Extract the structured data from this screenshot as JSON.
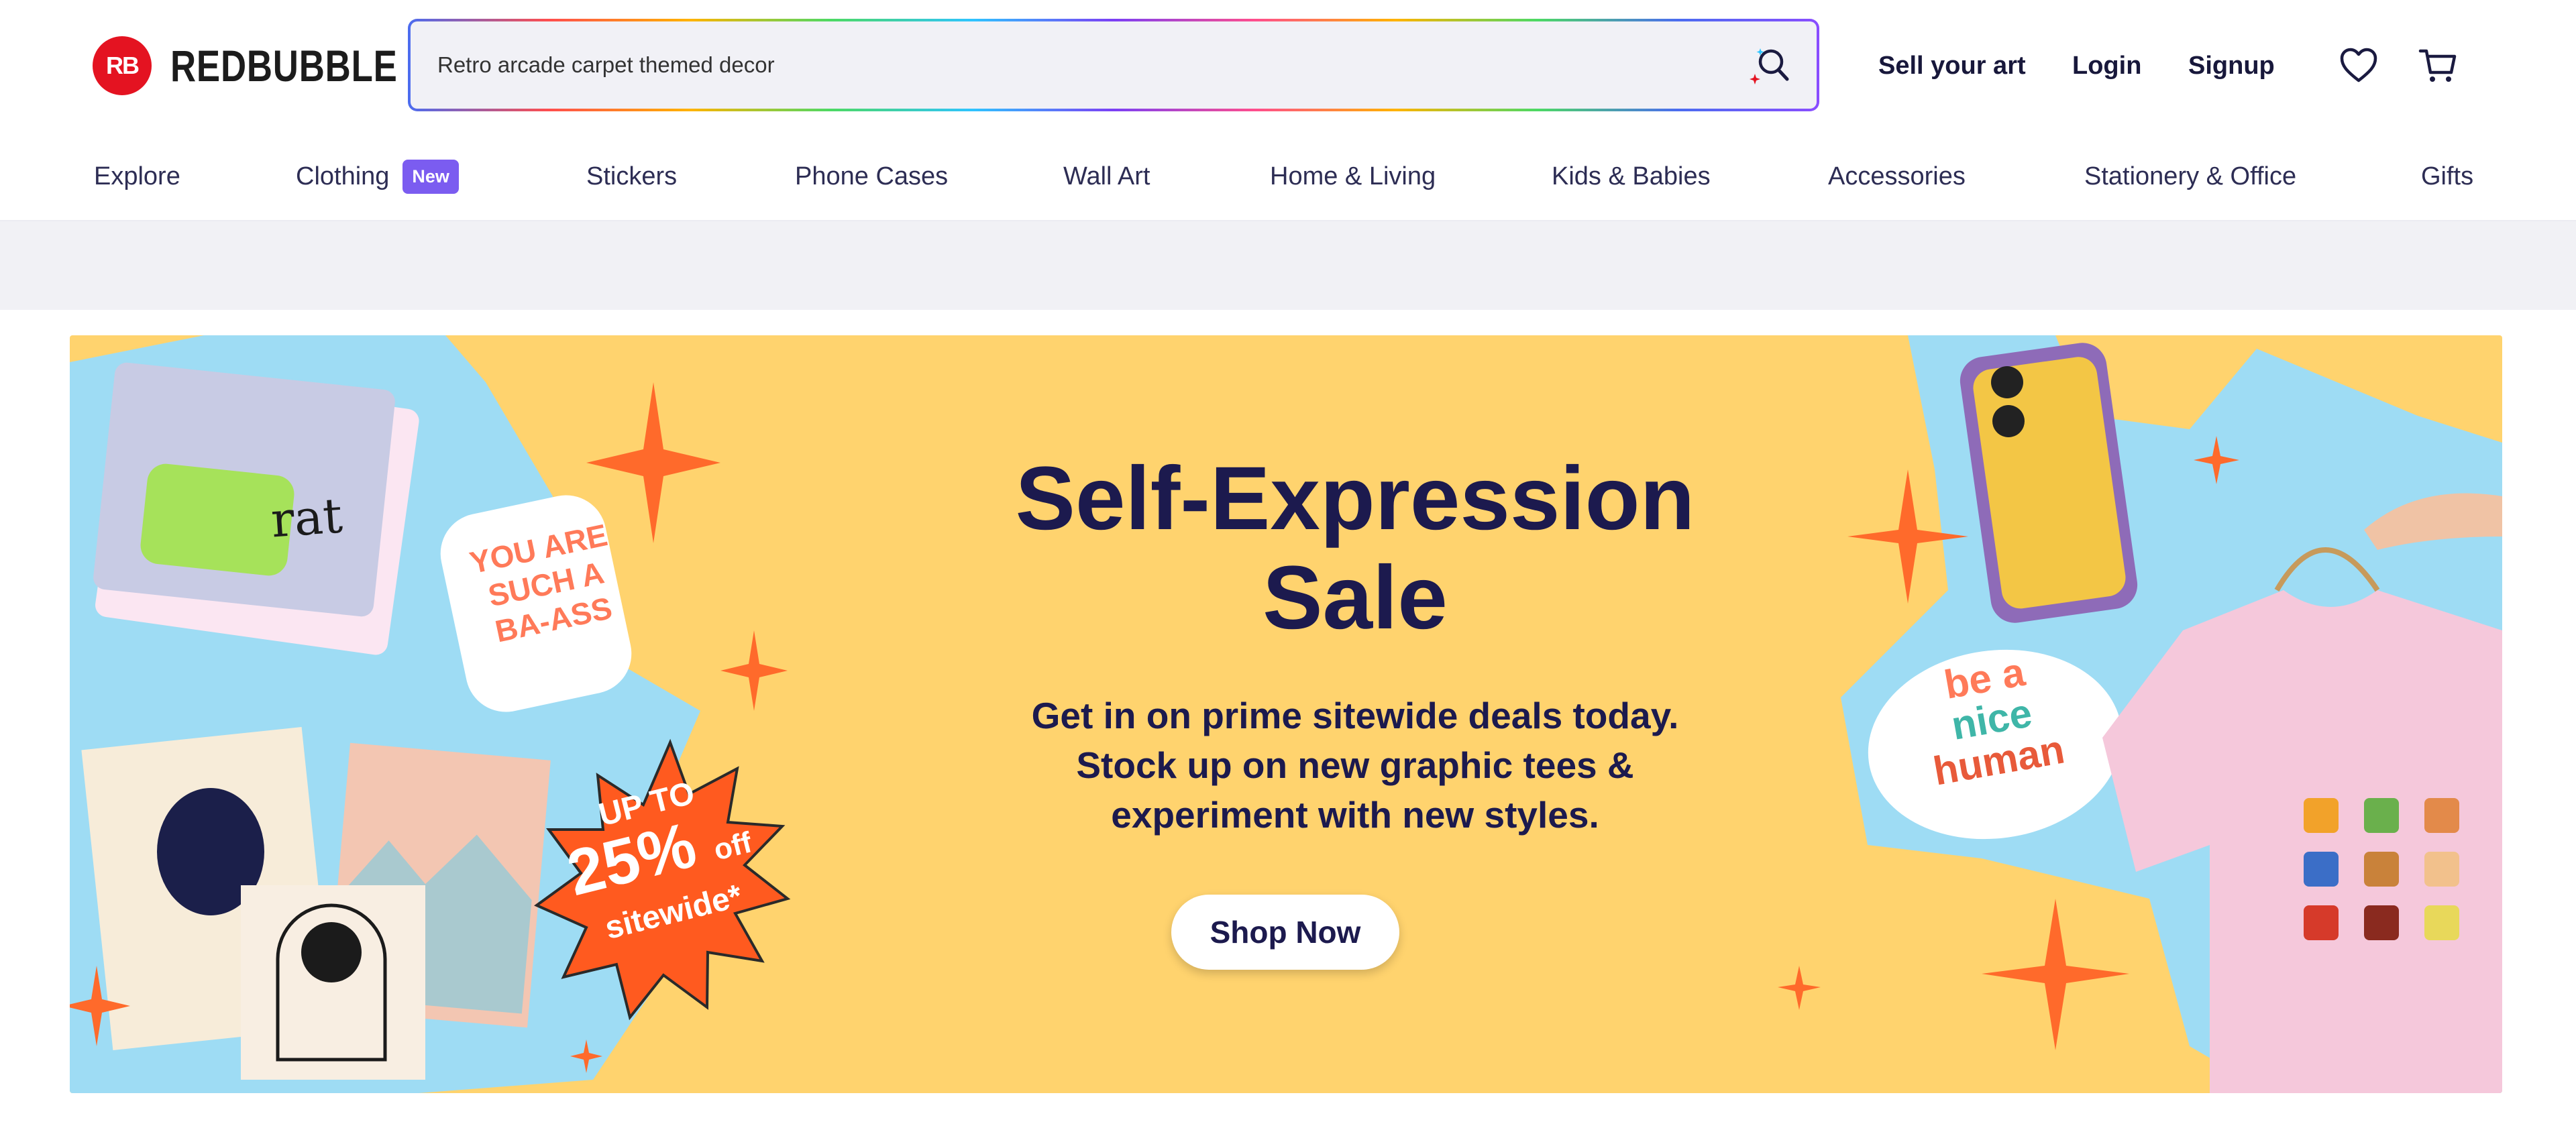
{
  "brand": {
    "logo_mark": "RB",
    "name": "REDBUBBLE",
    "color": "#e41321"
  },
  "search": {
    "value": "Retro arcade carpet themed decor",
    "icon": "search-sparkle-icon"
  },
  "header_links": {
    "sell": "Sell your art",
    "login": "Login",
    "signup": "Signup"
  },
  "header_icons": {
    "wishlist": "heart-icon",
    "cart": "cart-icon"
  },
  "categories": [
    {
      "label": "Explore"
    },
    {
      "label": "Clothing",
      "badge": "New"
    },
    {
      "label": "Stickers"
    },
    {
      "label": "Phone Cases"
    },
    {
      "label": "Wall Art"
    },
    {
      "label": "Home & Living"
    },
    {
      "label": "Kids & Babies"
    },
    {
      "label": "Accessories"
    },
    {
      "label": "Stationery & Office"
    },
    {
      "label": "Gifts"
    }
  ],
  "hero": {
    "title_line1": "Self-Expression",
    "title_line2": "Sale",
    "subtitle_line1": "Get in on prime sitewide deals today.",
    "subtitle_line2": "Stock up on new graphic tees &",
    "subtitle_line3": "experiment with new styles.",
    "cta": "Shop Now",
    "background_color": "#ffd36e",
    "accent_color": "#ff6a2b",
    "promo_badge": {
      "line1": "UP TO",
      "line2": "25%",
      "line3": "off",
      "line4": "sitewide",
      "mark": "*"
    },
    "sticker_left": {
      "text": "YOU ARE SUCH A BA-ASS"
    },
    "sticker_right": {
      "text1": "be a",
      "text2": "nice",
      "text3": "human"
    },
    "tee_text": "rat"
  }
}
